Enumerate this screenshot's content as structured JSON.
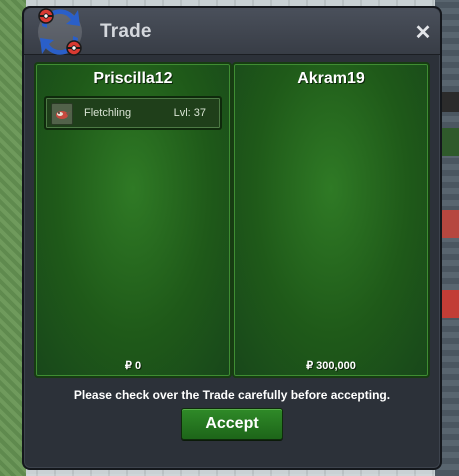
{
  "window": {
    "title": "Trade",
    "close_icon": "close-icon",
    "logo_icon": "trade-arrows-icon"
  },
  "left_panel": {
    "player": "Priscilla12",
    "item": {
      "icon": "pokemon-sprite-icon",
      "name": "Fletchling",
      "level": "Lvl: 37"
    },
    "money": "₽ 0"
  },
  "right_panel": {
    "player": "Akram19",
    "money": "₽ 300,000"
  },
  "notice": "Please check over the Trade carefully before accepting.",
  "accept_label": "Accept",
  "colors": {
    "window_bg": "#2c3139",
    "panel_green": "#2f7a25",
    "button_green": "#2f8a28"
  }
}
